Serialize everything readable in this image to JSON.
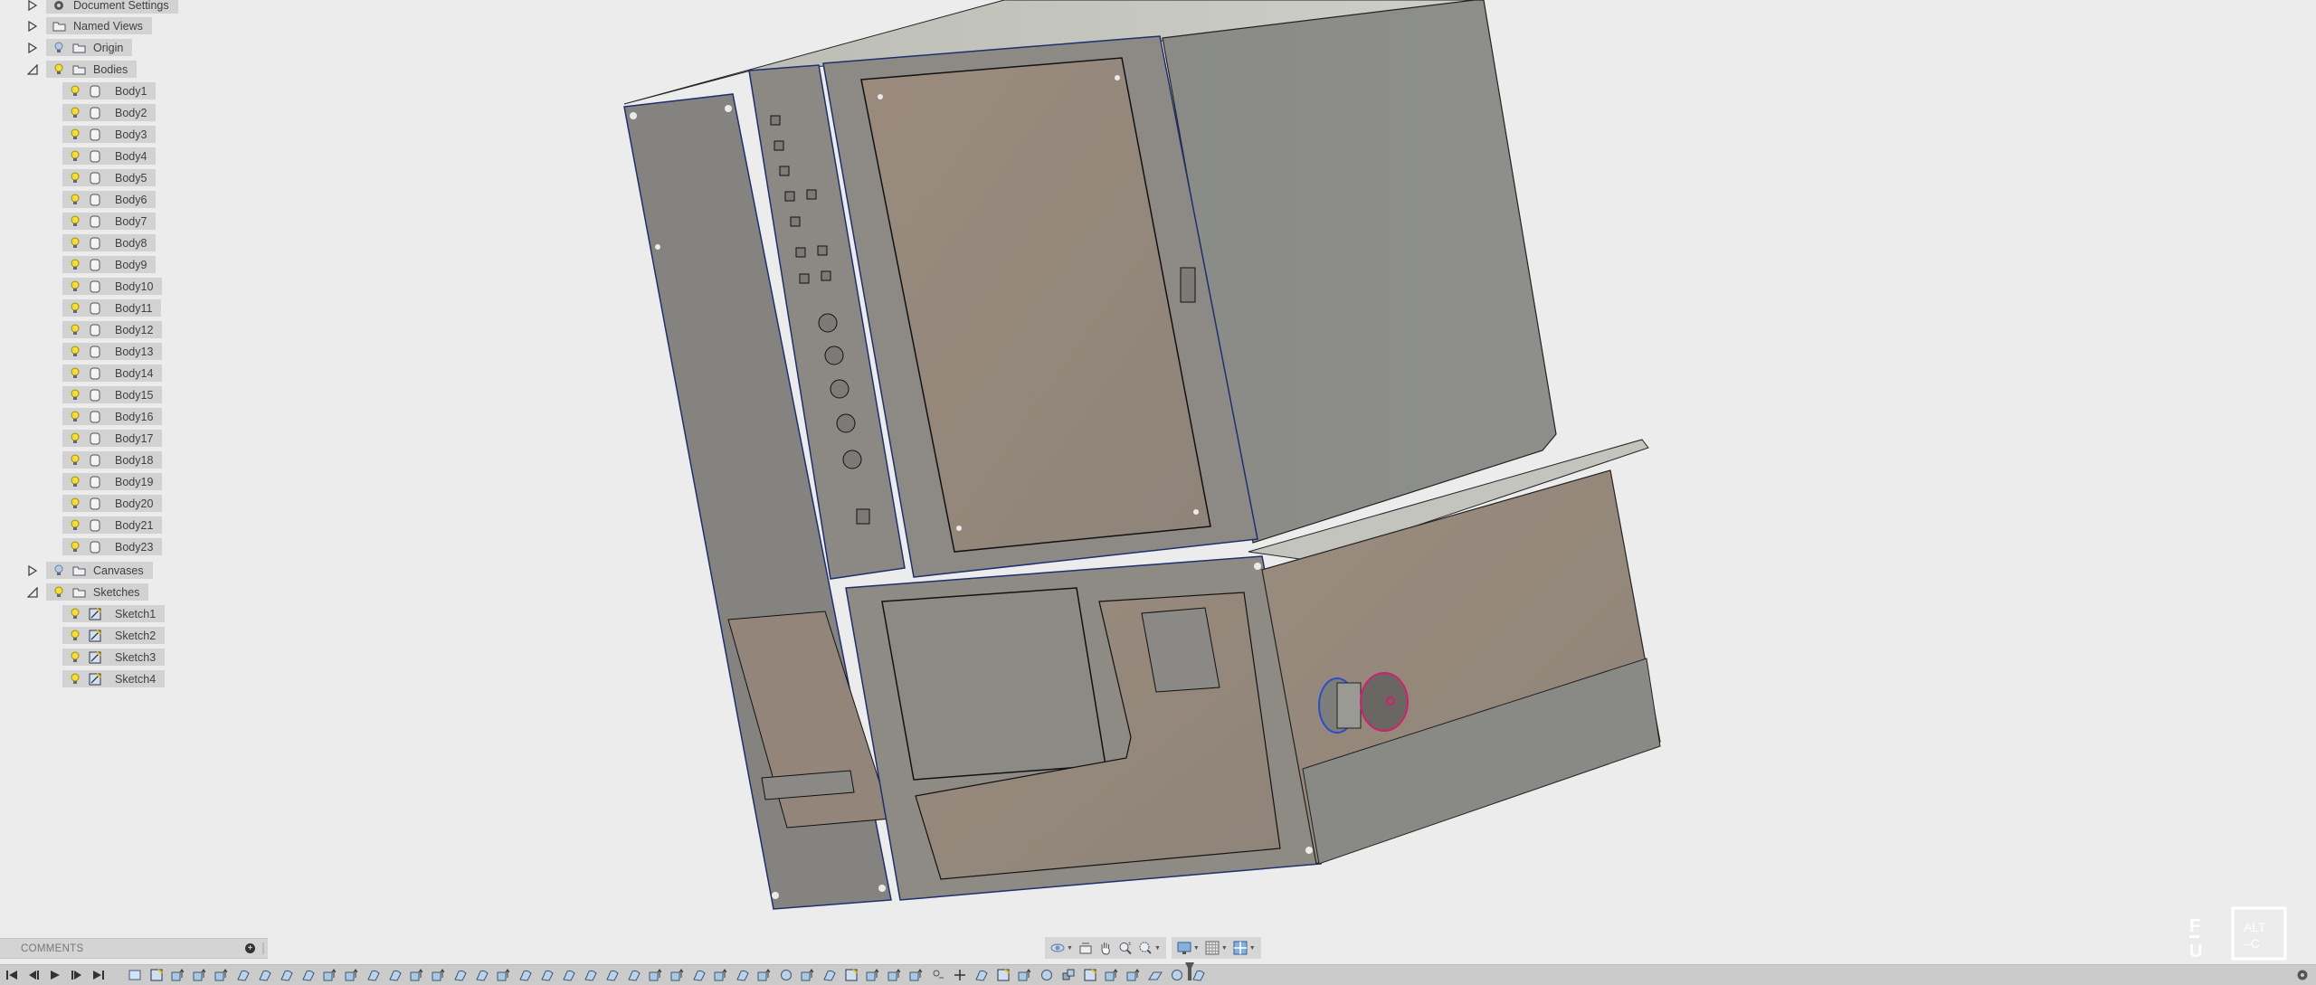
{
  "browser": {
    "document_settings": {
      "label": "Document Settings",
      "expanded": false,
      "icon": "gear-icon"
    },
    "named_views": {
      "label": "Named Views",
      "expanded": false,
      "icon": "folder-icon"
    },
    "origin": {
      "label": "Origin",
      "expanded": false,
      "visible_icon": "lightbulb-off-icon",
      "icon": "folder-icon"
    },
    "bodies": {
      "label": "Bodies",
      "expanded": true,
      "visible_icon": "lightbulb-on-icon",
      "icon": "folder-icon",
      "items": [
        {
          "label": "Body1"
        },
        {
          "label": "Body2"
        },
        {
          "label": "Body3"
        },
        {
          "label": "Body4"
        },
        {
          "label": "Body5"
        },
        {
          "label": "Body6"
        },
        {
          "label": "Body7"
        },
        {
          "label": "Body8"
        },
        {
          "label": "Body9"
        },
        {
          "label": "Body10"
        },
        {
          "label": "Body11"
        },
        {
          "label": "Body12"
        },
        {
          "label": "Body13"
        },
        {
          "label": "Body14"
        },
        {
          "label": "Body15"
        },
        {
          "label": "Body16"
        },
        {
          "label": "Body17"
        },
        {
          "label": "Body18"
        },
        {
          "label": "Body19"
        },
        {
          "label": "Body20"
        },
        {
          "label": "Body21"
        },
        {
          "label": "Body23"
        }
      ]
    },
    "canvases": {
      "label": "Canvases",
      "expanded": false,
      "visible_icon": "lightbulb-off-icon",
      "icon": "folder-icon"
    },
    "sketches": {
      "label": "Sketches",
      "expanded": true,
      "visible_icon": "lightbulb-on-icon",
      "icon": "folder-icon",
      "items": [
        {
          "label": "Sketch1"
        },
        {
          "label": "Sketch2"
        },
        {
          "label": "Sketch3"
        },
        {
          "label": "Sketch4"
        }
      ]
    }
  },
  "comments": {
    "label": "COMMENTS",
    "add_icon": "plus-circle-icon"
  },
  "navbar": {
    "groups": [
      [
        "orbit-icon",
        "look-at-icon",
        "pan-icon",
        "zoom-icon",
        "fit-icon"
      ],
      [
        "display-settings-icon",
        "grid-icon",
        "viewports-icon"
      ]
    ]
  },
  "timeline": {
    "controls": [
      "go-to-start-icon",
      "step-back-icon",
      "play-icon",
      "step-forward-icon",
      "go-to-end-icon"
    ],
    "features": [
      "canvas",
      "sketch",
      "extrude",
      "extrude",
      "extrude",
      "fillet",
      "fillet",
      "fillet",
      "fillet",
      "extrude",
      "extrude",
      "fillet",
      "fillet",
      "extrude",
      "extrude",
      "fillet",
      "fillet",
      "extrude",
      "fillet",
      "fillet",
      "fillet",
      "fillet",
      "fillet",
      "fillet",
      "extrude",
      "extrude",
      "fillet",
      "extrude",
      "fillet",
      "extrude",
      "revolve",
      "extrude",
      "fillet",
      "sketch",
      "extrude",
      "extrude",
      "extrude",
      "construction",
      "move",
      "fillet",
      "sketch",
      "extrude",
      "revolve",
      "combine",
      "sketch",
      "extrude",
      "extrude",
      "sheet",
      "revolve",
      "fillet"
    ]
  },
  "logo": {
    "left_text": "F–U",
    "box_text_1": "ALT",
    "box_text_2": "–C"
  },
  "colors": {
    "background": "#ececec",
    "panel_node": "#d2d2d2",
    "model_face": "#8a8985",
    "model_face_warm": "#958677",
    "model_top": "#c9cbc4",
    "edge_highlight": "#2b4fc8",
    "selection_magenta": "#d0206e"
  }
}
